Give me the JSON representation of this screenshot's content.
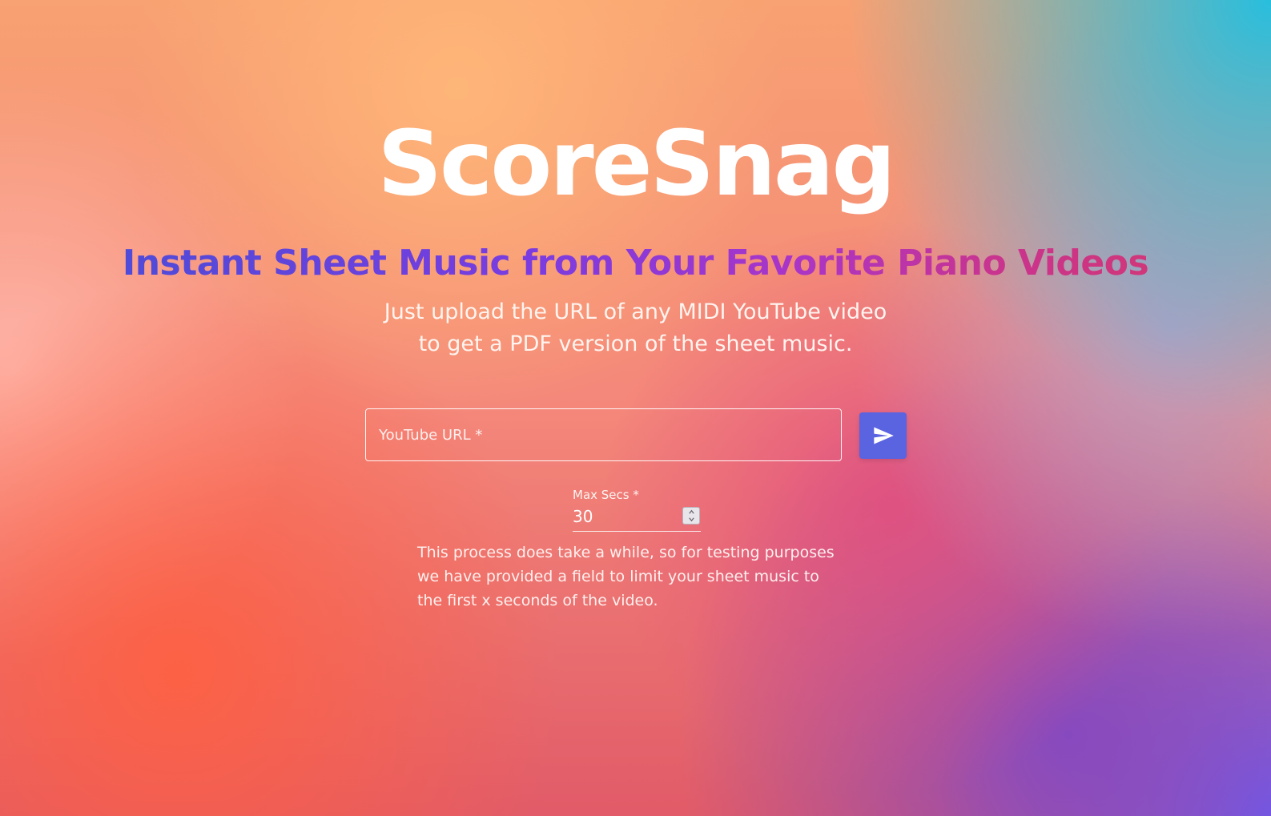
{
  "brand": {
    "name": "ScoreSnag"
  },
  "hero": {
    "tagline": "Instant Sheet Music from Your Favorite Piano Videos",
    "subtitle_lines": [
      "Just upload the URL of any MIDI YouTube video",
      "to get a PDF version of the sheet music."
    ]
  },
  "form": {
    "url_field": {
      "placeholder": "YouTube URL *",
      "value": ""
    },
    "submit": {
      "icon": "send-icon",
      "color": "#5a63e0"
    },
    "max_secs": {
      "label": "Max Secs *",
      "value": "30"
    },
    "note_lines": [
      "This process does take a while, so for testing purposes",
      "we have provided a field to limit your sheet music to",
      "the first x seconds of the video."
    ]
  }
}
